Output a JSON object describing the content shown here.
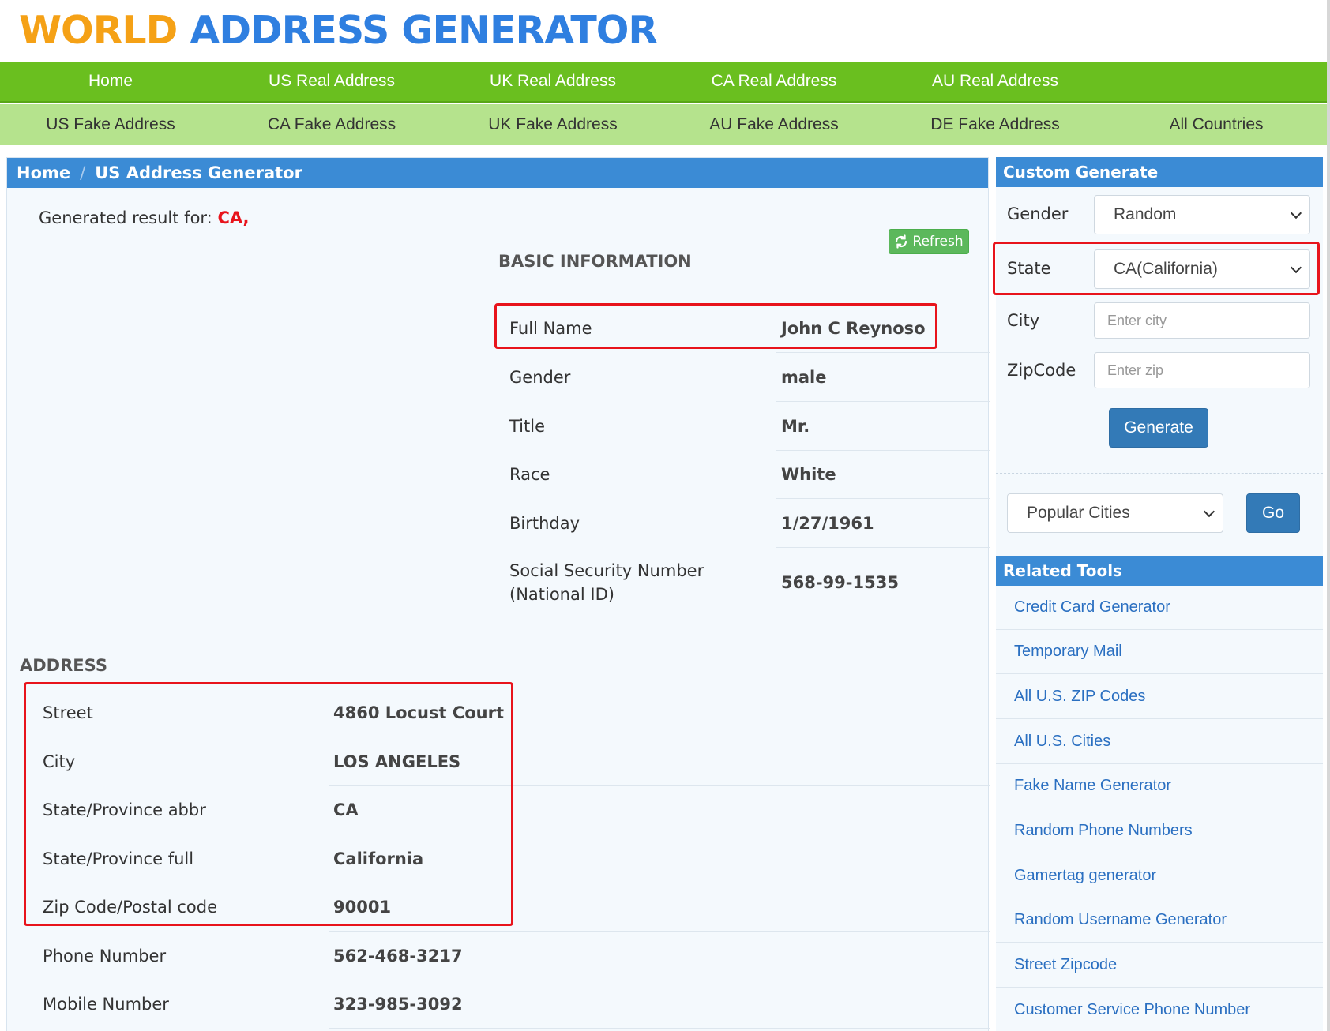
{
  "logo": {
    "part1": "WORLD",
    "part2": "ADDRESS GENERATOR"
  },
  "nav_primary": [
    "Home",
    "US Real Address",
    "UK Real Address",
    "CA Real Address",
    "AU Real Address"
  ],
  "nav_secondary": [
    "US Fake Address",
    "CA Fake Address",
    "UK Fake Address",
    "AU Fake Address",
    "DE Fake Address",
    "All Countries"
  ],
  "breadcrumb": {
    "home": "Home",
    "separator": "/",
    "current": "US Address Generator"
  },
  "result": {
    "prefix": "Generated result for:",
    "value": "CA,"
  },
  "refresh": {
    "icon": "refresh-icon",
    "label": "Refresh"
  },
  "basic": {
    "title": "BASIC INFORMATION",
    "rows": [
      {
        "label": "Full Name",
        "value": "John C Reynoso"
      },
      {
        "label": "Gender",
        "value": "male"
      },
      {
        "label": "Title",
        "value": "Mr."
      },
      {
        "label": "Race",
        "value": "White"
      },
      {
        "label": "Birthday",
        "value": "1/27/1961"
      },
      {
        "label": "Social Security Number\n(National ID)",
        "value": "568-99-1535"
      }
    ]
  },
  "address": {
    "title": "ADDRESS",
    "rows": [
      {
        "label": "Street",
        "value": "4860 Locust Court"
      },
      {
        "label": "City",
        "value": "LOS ANGELES"
      },
      {
        "label": "State/Province abbr",
        "value": "CA"
      },
      {
        "label": "State/Province full",
        "value": "California"
      },
      {
        "label": "Zip Code/Postal code",
        "value": "90001"
      },
      {
        "label": "Phone Number",
        "value": "562-468-3217"
      },
      {
        "label": "Mobile Number",
        "value": "323-985-3092"
      }
    ]
  },
  "custom": {
    "title": "Custom Generate",
    "gender_label": "Gender",
    "gender_value": "Random",
    "state_label": "State",
    "state_value": "CA(California)",
    "city_label": "City",
    "city_placeholder": "Enter city",
    "zip_label": "ZipCode",
    "zip_placeholder": "Enter zip",
    "generate": "Generate",
    "popular_cities": "Popular Cities",
    "go": "Go"
  },
  "related": {
    "title": "Related Tools",
    "items": [
      "Credit Card Generator",
      "Temporary Mail",
      "All U.S. ZIP Codes",
      "All U.S. Cities",
      "Fake Name Generator",
      "Random Phone Numbers",
      "Gamertag generator",
      "Random Username Generator",
      "Street Zipcode",
      "Customer Service Phone Number"
    ]
  },
  "colors": {
    "highlight": "#e8141c",
    "brand_orange": "#f5a116",
    "brand_blue": "#2f7fe0",
    "nav_green": "#6abf1f",
    "nav_light_green": "#b5e38d",
    "panel_blue": "#3b8bd5"
  }
}
